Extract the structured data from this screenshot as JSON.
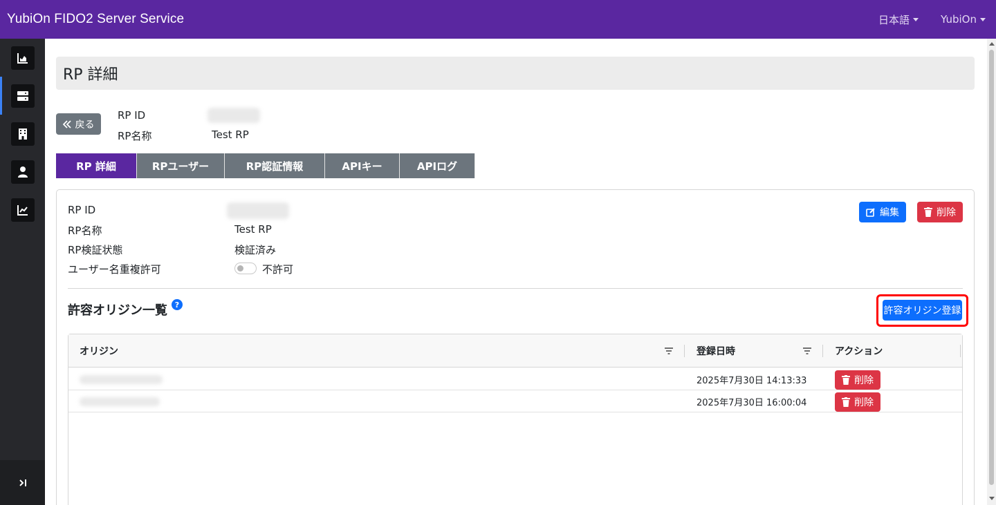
{
  "header": {
    "brand": "YubiOn FIDO2 Server Service",
    "language": "日本語",
    "user": "YubiOn"
  },
  "sidebar": {
    "items": [
      {
        "icon": "area-chart-icon"
      },
      {
        "icon": "server-icon"
      },
      {
        "icon": "building-icon"
      },
      {
        "icon": "user-icon"
      },
      {
        "icon": "line-chart-icon"
      }
    ],
    "expand_icon": "expand-icon"
  },
  "page": {
    "title": "RP 詳細",
    "back_label": "戻る",
    "rp_id_label": "RP ID",
    "rp_name_label": "RP名称",
    "rp_name_value": "Test RP"
  },
  "tabs": [
    "RP 詳細",
    "RPユーザー",
    "RP認証情報",
    "APIキー",
    "APIログ"
  ],
  "detail": {
    "rp_id_label": "RP ID",
    "rp_name_label": "RP名称",
    "rp_name_value": "Test RP",
    "verify_label": "RP検証状態",
    "verify_value": "検証済み",
    "dup_label": "ユーザー名重複許可",
    "dup_value": "不許可",
    "edit_label": "編集",
    "delete_label": "削除"
  },
  "origins": {
    "title": "許容オリジン一覧",
    "help": "?",
    "register_label": "許容オリジン登録",
    "columns": [
      "オリジン",
      "登録日時",
      "アクション"
    ],
    "rows": [
      {
        "date": "2025年7月30日 14:13:33",
        "action": "削除"
      },
      {
        "date": "2025年7月30日 16:00:04",
        "action": "削除"
      }
    ]
  },
  "colors": {
    "brand": "#5a27a0",
    "primary": "#0d6efd",
    "danger": "#dc3545",
    "secondary": "#6c757d",
    "sidebar": "#27282c",
    "highlight": "#ff0000"
  }
}
